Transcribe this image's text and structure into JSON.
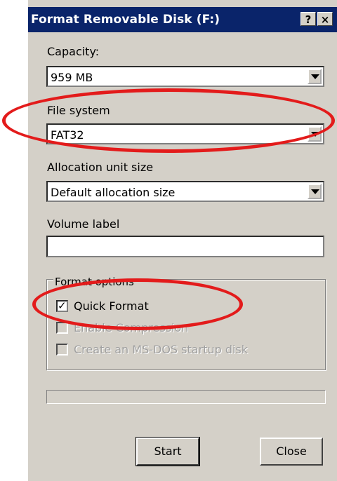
{
  "window": {
    "title": "Format Removable Disk (F:)",
    "help_label": "?",
    "close_label": "×"
  },
  "capacity": {
    "label": "Capacity:",
    "value": "959 MB"
  },
  "file_system": {
    "label": "File system",
    "value": "FAT32"
  },
  "allocation": {
    "label": "Allocation unit size",
    "value": "Default allocation size"
  },
  "volume_label": {
    "label": "Volume label",
    "value": ""
  },
  "format_options": {
    "title": "Format options",
    "quick_format": {
      "label": "Quick Format",
      "checked": true
    },
    "enable_compression": {
      "label": "Enable Compression",
      "checked": false
    },
    "msdos_startup": {
      "label": "Create an MS-DOS startup disk",
      "checked": false
    }
  },
  "buttons": {
    "start": "Start",
    "close": "Close"
  },
  "annotation_color": "#e31b1b"
}
